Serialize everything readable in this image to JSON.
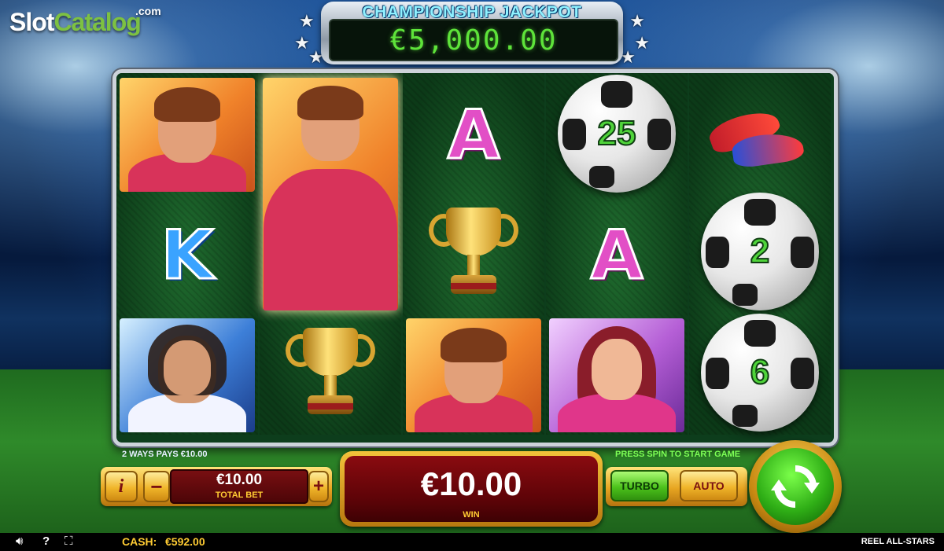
{
  "logo": {
    "part1": "Slot",
    "part2": "Catalog",
    "suffix": ".com"
  },
  "jackpot": {
    "title": "CHAMPIONSHIP JACKPOT",
    "value": "€5,000.00"
  },
  "reels": {
    "reel1": [
      "orange-player-portrait",
      "letter-K",
      "bearded-player-portrait"
    ],
    "reel2": [
      "orange-player-tall-portrait",
      "trophy"
    ],
    "reel3": [
      "letter-A",
      "trophy",
      "orange-player-portrait"
    ],
    "reel4": [
      "soccer-ball",
      "letter-A",
      "woman-player-portrait"
    ],
    "reel5": [
      "boots",
      "soccer-ball",
      "soccer-ball"
    ],
    "symbols": {
      "letter_a": "A",
      "letter_k": "K",
      "ball_25": "25",
      "ball_2": "2",
      "ball_6": "6"
    }
  },
  "controls": {
    "ways_pays": "2 WAYS PAYS €10.00",
    "press_spin": "PRESS SPIN TO START GAME",
    "info": "i",
    "minus": "−",
    "plus": "+",
    "total_bet_value": "€10.00",
    "total_bet_label": "TOTAL BET",
    "win_value": "€10.00",
    "win_label": "WIN",
    "turbo": "TURBO",
    "auto": "AUTO"
  },
  "status_bar": {
    "sound_icon": "speaker-icon",
    "help": "?",
    "fullscreen_icon": "fullscreen-icon",
    "cash_label": "CASH:",
    "cash_value": "€592.00",
    "game_name": "REEL ALL-STARS"
  },
  "colors": {
    "jackpot_digits": "#5ee33a",
    "gold": "#f0b52a",
    "win_panel": "#7a0f12",
    "spin": "#2fae16"
  }
}
